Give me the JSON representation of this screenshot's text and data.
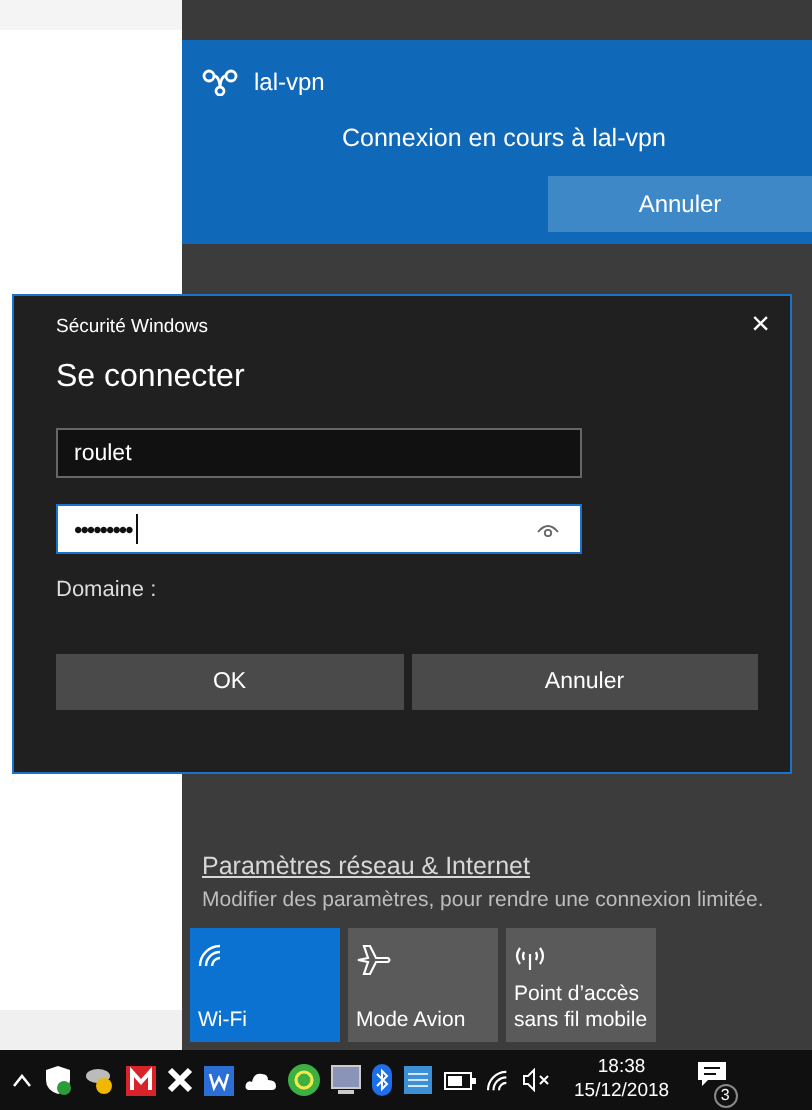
{
  "vpn_flyout": {
    "name": "lal-vpn",
    "status": "Connexion en cours à lal-vpn",
    "cancel_button": "Annuler"
  },
  "dialog": {
    "title": "Sécurité Windows",
    "close": "×",
    "heading": "Se connecter",
    "username": "roulet",
    "password": "•••••••••",
    "password_focused": true,
    "domain_label": "Domaine :",
    "buttons": [
      "OK",
      "Annuler"
    ]
  },
  "network_settings": {
    "link": "Paramètres réseau & Internet",
    "description": "Modifier des paramètres, pour rendre une connexion limitée."
  },
  "quick_actions": [
    {
      "kind": "wifi",
      "label": "Wi-Fi",
      "on": true
    },
    {
      "kind": "airplane",
      "label": "Mode Avion",
      "on": false
    },
    {
      "kind": "hotspot",
      "label": "Point d’accès sans fil mobile",
      "on": false
    }
  ],
  "taskbar": {
    "time": "18:38",
    "date": "15/12/2018",
    "notification_count": "3"
  }
}
